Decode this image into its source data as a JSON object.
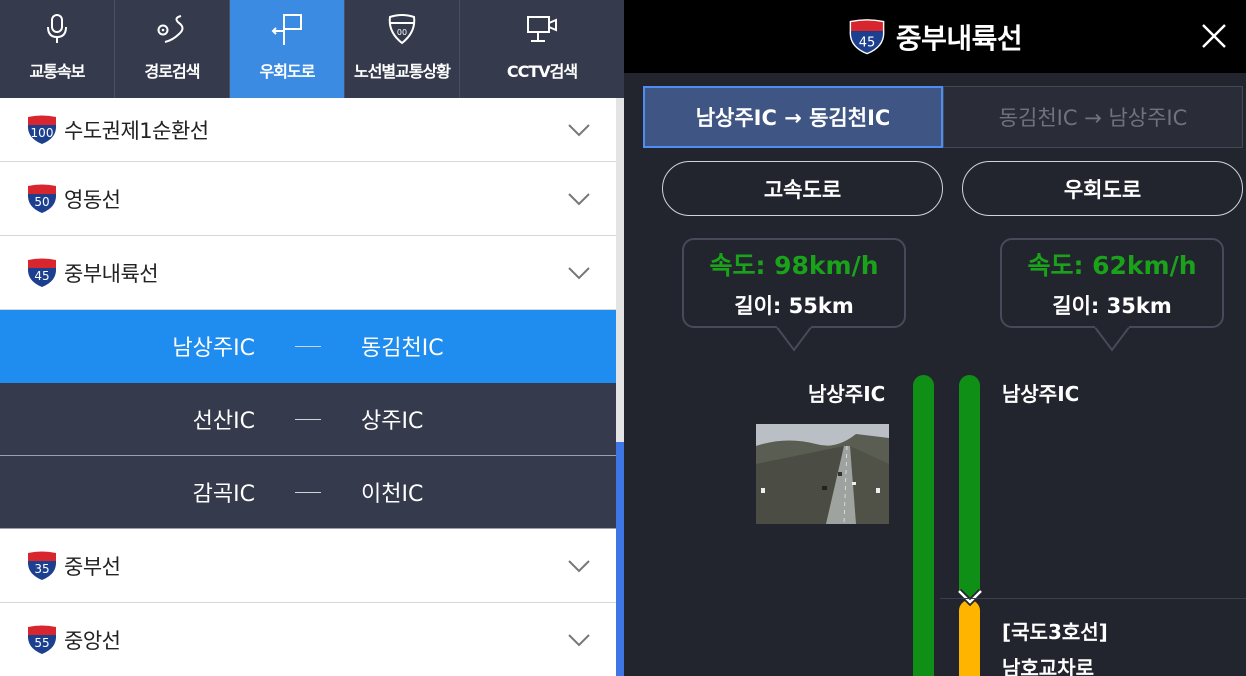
{
  "nav": [
    {
      "label": "교통속보",
      "icon": "microphone-icon"
    },
    {
      "label": "경로검색",
      "icon": "route-icon"
    },
    {
      "label": "우회도로",
      "icon": "detour-sign-icon"
    },
    {
      "label": "노선별교통상황",
      "icon": "highway-shield-icon"
    },
    {
      "label": "CCTV검색",
      "icon": "cctv-camera-icon"
    }
  ],
  "nav_active": "우회도로",
  "roads": [
    {
      "name": "수도권제1순환선",
      "num": "100"
    },
    {
      "name": "영동선",
      "num": "50"
    },
    {
      "name": "중부내륙선",
      "num": "45"
    },
    {
      "name": "중부선",
      "num": "35"
    },
    {
      "name": "중앙선",
      "num": "55"
    }
  ],
  "sections": [
    {
      "from": "남상주IC",
      "to": "동김천IC"
    },
    {
      "from": "선산IC",
      "to": "상주IC"
    },
    {
      "from": "감곡IC",
      "to": "이천IC"
    }
  ],
  "detail": {
    "title": "중부내륙선",
    "badge": "45",
    "dir_tabs": [
      "남상주IC → 동김천IC",
      "동김천IC → 남상주IC"
    ],
    "road_types": [
      "고속도로",
      "우회도로"
    ],
    "highway": {
      "speed": "속도: 98km/h",
      "length": "길이: 55km",
      "start": "남상주IC"
    },
    "detour": {
      "speed": "속도: 62km/h",
      "length": "길이: 35km",
      "start": "남상주IC",
      "via_road": "[국도3호선]",
      "via_point": "남호교차로"
    }
  },
  "colors": {
    "accent": "#1f8def",
    "speed_green": "#1aa21a",
    "bar_green": "#0f8f16",
    "bar_orange": "#ffb400",
    "shield_red": "#d8262f",
    "shield_blue": "#1c3f8f"
  }
}
